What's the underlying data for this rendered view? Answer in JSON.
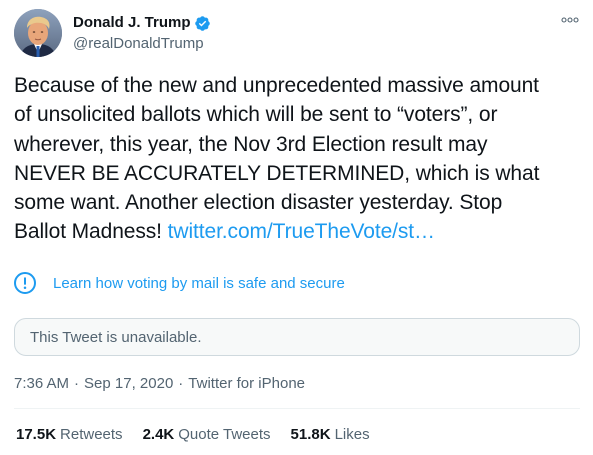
{
  "author": {
    "display_name": "Donald J. Trump",
    "handle": "@realDonaldTrump",
    "verified": true,
    "avatar_icon": "profile-photo"
  },
  "tweet": {
    "text_lines": [
      "Because of the new and unprecedented massive amount",
      "of unsolicited ballots which will be sent to “voters”, or",
      "wherever, this year, the Nov 3rd Election result may",
      "NEVER BE ACCURATELY DETERMINED, which is what",
      "some want. Another election disaster yesterday. Stop"
    ],
    "last_line_text": "Ballot Madness! ",
    "link_text": "twitter.com/TrueTheVote/st…"
  },
  "notice": {
    "icon": "exclamation-circle-icon",
    "label": "Learn how voting by mail is safe and secure"
  },
  "quoted": {
    "unavailable_text": "This Tweet is unavailable."
  },
  "meta": {
    "time": "7:36 AM",
    "separator": "·",
    "date": "Sep 17, 2020",
    "source": "Twitter for iPhone"
  },
  "stats": {
    "retweets": {
      "count": "17.5K",
      "label": "Retweets"
    },
    "quotes": {
      "count": "2.4K",
      "label": "Quote Tweets"
    },
    "likes": {
      "count": "51.8K",
      "label": "Likes"
    }
  },
  "colors": {
    "accent": "#1d9bf0",
    "text": "#0f1419",
    "secondary": "#536471",
    "border": "#cfd9de"
  }
}
